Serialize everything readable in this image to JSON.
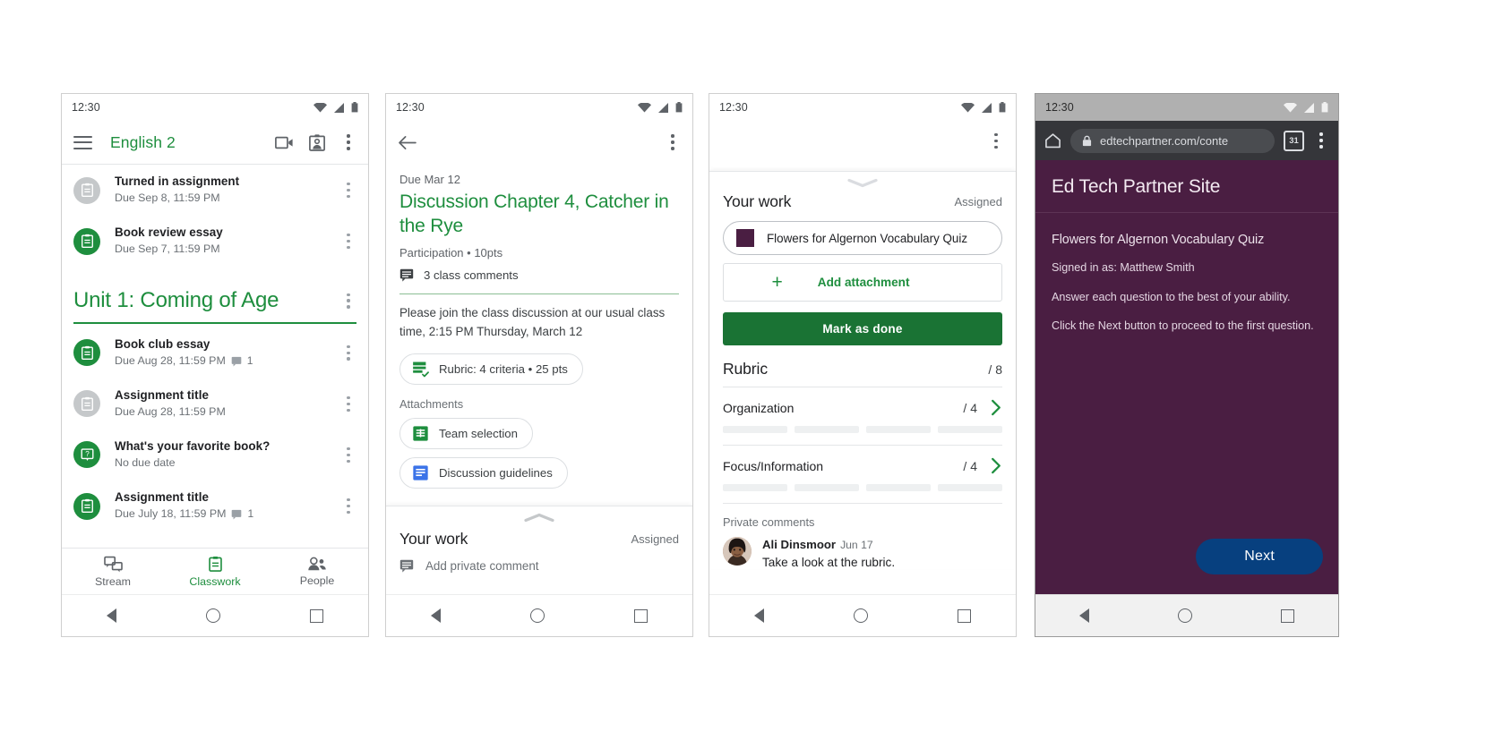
{
  "phones": [
    {
      "id": "classwork",
      "status_time": "12:30",
      "appbar": {
        "title": "English 2"
      },
      "top_items": [
        {
          "title": "Turned in assignment",
          "due": "Due Sep 8, 11:59 PM",
          "icon": "assignment-icon",
          "state": "grey",
          "comments": null
        },
        {
          "title": "Book review essay",
          "due": "Due Sep 7, 11:59 PM",
          "icon": "assignment-icon",
          "state": "green",
          "comments": null
        }
      ],
      "section": {
        "title": "Unit 1: Coming of Age"
      },
      "section_items": [
        {
          "title": "Book club essay",
          "due": "Due Aug 28, 11:59 PM",
          "icon": "assignment-icon",
          "state": "green",
          "comments": "1"
        },
        {
          "title": "Assignment title",
          "due": "Due Aug 28, 11:59 PM",
          "icon": "assignment-icon",
          "state": "grey",
          "comments": null
        },
        {
          "title": "What's your favorite book?",
          "due": "No due date",
          "icon": "question-icon",
          "state": "green",
          "comments": null
        },
        {
          "title": "Assignment title",
          "due": "Due July 18, 11:59 PM",
          "icon": "assignment-icon",
          "state": "green",
          "comments": "1"
        }
      ],
      "bottom_nav": [
        {
          "label": "Stream",
          "icon": "stream-icon",
          "active": false
        },
        {
          "label": "Classwork",
          "icon": "classwork-icon",
          "active": true
        },
        {
          "label": "People",
          "icon": "people-icon",
          "active": false
        }
      ]
    },
    {
      "id": "assignment-detail",
      "status_time": "12:30",
      "due": "Due Mar 12",
      "title": "Discussion Chapter 4, Catcher in the Rye",
      "meta": "Participation • 10pts",
      "class_comments": "3 class comments",
      "body": "Please join the class discussion at our usual class time, 2:15 PM Thursday, March 12",
      "rubric_chip": "Rubric: 4 criteria • 25 pts",
      "attachments_label": "Attachments",
      "attachments": [
        {
          "label": "Team selection",
          "icon": "sheets-icon"
        },
        {
          "label": "Discussion guidelines",
          "icon": "docs-icon"
        }
      ],
      "your_work": {
        "label": "Your work",
        "status": "Assigned"
      },
      "add_private_comment": "Add private comment"
    },
    {
      "id": "your-work-sheet",
      "status_time": "12:30",
      "your_work": {
        "label": "Your work",
        "status": "Assigned"
      },
      "attached_work": "Flowers for Algernon Vocabulary Quiz",
      "attached_work_color": "#4a1e42",
      "add_attachment": "Add attachment",
      "mark_as_done": "Mark as done",
      "rubric": {
        "label": "Rubric",
        "score": "/ 8"
      },
      "criteria": [
        {
          "name": "Organization",
          "score": "/ 4"
        },
        {
          "name": "Focus/Information",
          "score": "/ 4"
        }
      ],
      "private_comments_label": "Private comments",
      "private_comment": {
        "author": "Ali Dinsmoor",
        "date": "Jun 17",
        "body": "Take a look at the rubric."
      }
    },
    {
      "id": "browser-quiz",
      "status_time": "12:30",
      "browser": {
        "url": "edtechpartner.com/conte",
        "tab_count": "31",
        "home_icon": "home-icon",
        "lock_icon": "lock-icon",
        "menu_icon": "kebab-menu-icon"
      },
      "site_title": "Ed Tech Partner Site",
      "quiz_title": "Flowers for Algernon Vocabulary Quiz",
      "lines": [
        "Signed in as: Matthew Smith",
        "Answer each question to the best of your ability.",
        "Click the Next button to proceed to the first question."
      ],
      "next_button": "Next",
      "accent": "#07407f",
      "page_bg": "#4a1e42"
    }
  ],
  "colors": {
    "green": "#1e8e3e",
    "dark_green": "#1a7334",
    "grey_icon": "#c5c8ca",
    "text": "#202124",
    "muted": "#6b7075"
  }
}
